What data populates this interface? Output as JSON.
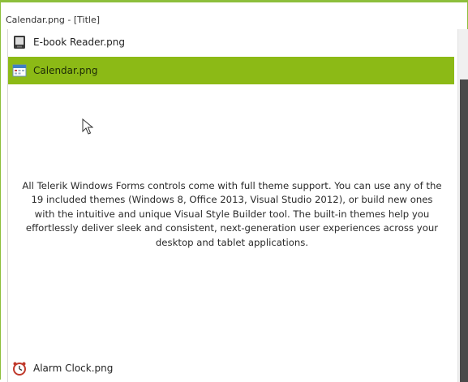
{
  "window": {
    "title": "Calendar.png - [Title]"
  },
  "list": {
    "items": [
      {
        "label": "E-book Reader.png",
        "icon": "ebook-reader-icon"
      },
      {
        "label": "Calendar.png",
        "icon": "calendar-icon",
        "selected": true
      },
      {
        "label": "Alarm Clock.png",
        "icon": "alarm-clock-icon"
      }
    ],
    "description": "All Telerik Windows Forms controls come with full theme support. You can use any of the 19 included themes (Windows 8, Office 2013, Visual Studio 2012), or build new ones with the intuitive and unique Visual Style Builder tool. The built-in themes help you effortlessly deliver sleek and consistent, next-generation user experiences across your desktop and tablet applications."
  },
  "colors": {
    "accent": "#8cba16",
    "frame_border": "#8dbf3c",
    "scroll_thumb": "#4a4a4a"
  }
}
